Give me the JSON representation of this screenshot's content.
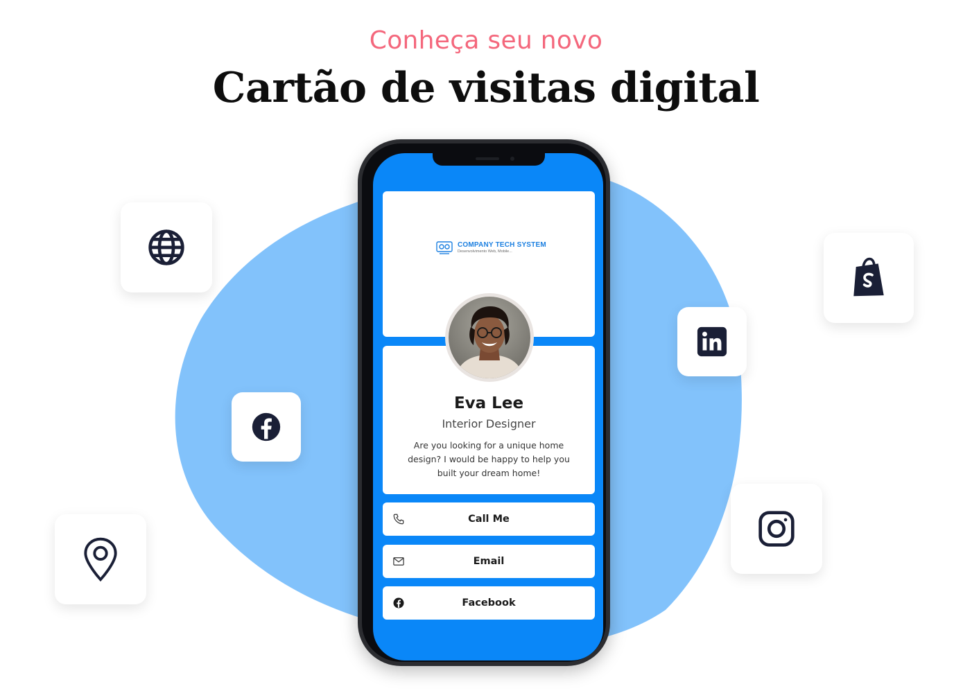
{
  "hero": {
    "kicker": "Conheça seu novo",
    "headline": "Cartão de visitas digital"
  },
  "colors": {
    "kicker": "#f4677c",
    "blob": "#82c2fb",
    "screen": "#0a87f8",
    "tile_icon": "#1a1f36"
  },
  "floating_icons": [
    "globe-icon",
    "facebook-icon",
    "location-pin-icon",
    "shopify-bag-icon",
    "linkedin-icon",
    "instagram-icon"
  ],
  "card": {
    "company": {
      "name": "COMPANY TECH SYSTEM",
      "tagline": "Desenvolvimento Web, Mobile..."
    },
    "profile": {
      "name": "Eva Lee",
      "role": "Interior Designer",
      "bio": "Are you looking for a unique home design? I would be happy to help you built your dream home!"
    },
    "buttons": [
      {
        "label": "Call Me",
        "icon": "phone-icon"
      },
      {
        "label": "Email",
        "icon": "envelope-icon"
      },
      {
        "label": "Facebook",
        "icon": "facebook-icon"
      }
    ]
  }
}
